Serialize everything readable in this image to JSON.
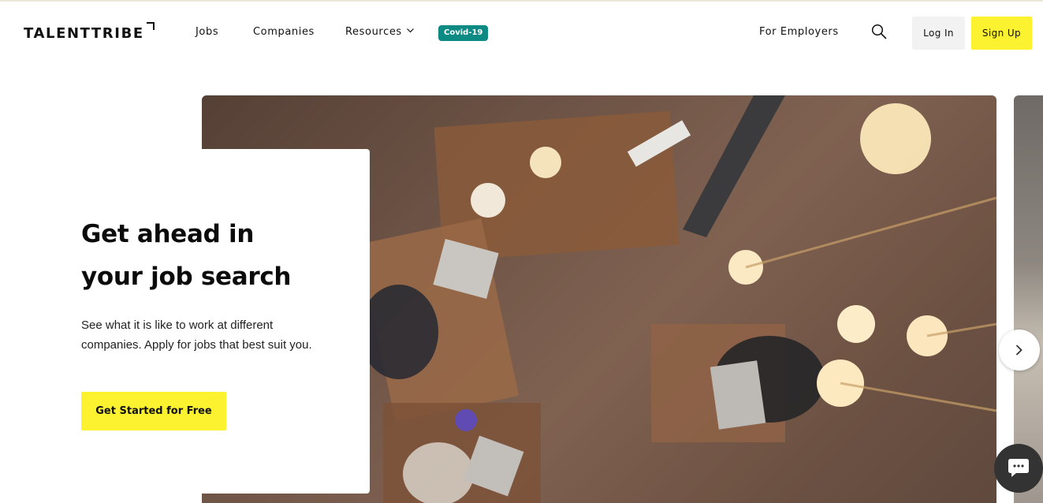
{
  "header": {
    "logo_text": "TALENTTRIBE",
    "nav": {
      "jobs": "Jobs",
      "companies": "Companies",
      "resources": "Resources",
      "covid": "Covid-19",
      "for_employers": "For Employers"
    },
    "login_label": "Log In",
    "signup_label": "Sign Up"
  },
  "hero": {
    "title_line1": "Get ahead in",
    "title_line2": "your job search",
    "description_line1": "See what it is like to work at different",
    "description_line2": "companies. Apply for jobs that best suit you.",
    "cta_label": "Get Started for Free"
  },
  "colors": {
    "accent_yellow": "#fcf230",
    "covid_badge": "#0e8a85",
    "login_bg": "#f2f2f2",
    "chat_button": "#333333"
  },
  "icons": {
    "search": "search-icon",
    "resources_dropdown": "chevron-down-icon",
    "carousel_next": "chevron-right-icon",
    "chat": "chat-bubble-icon"
  }
}
